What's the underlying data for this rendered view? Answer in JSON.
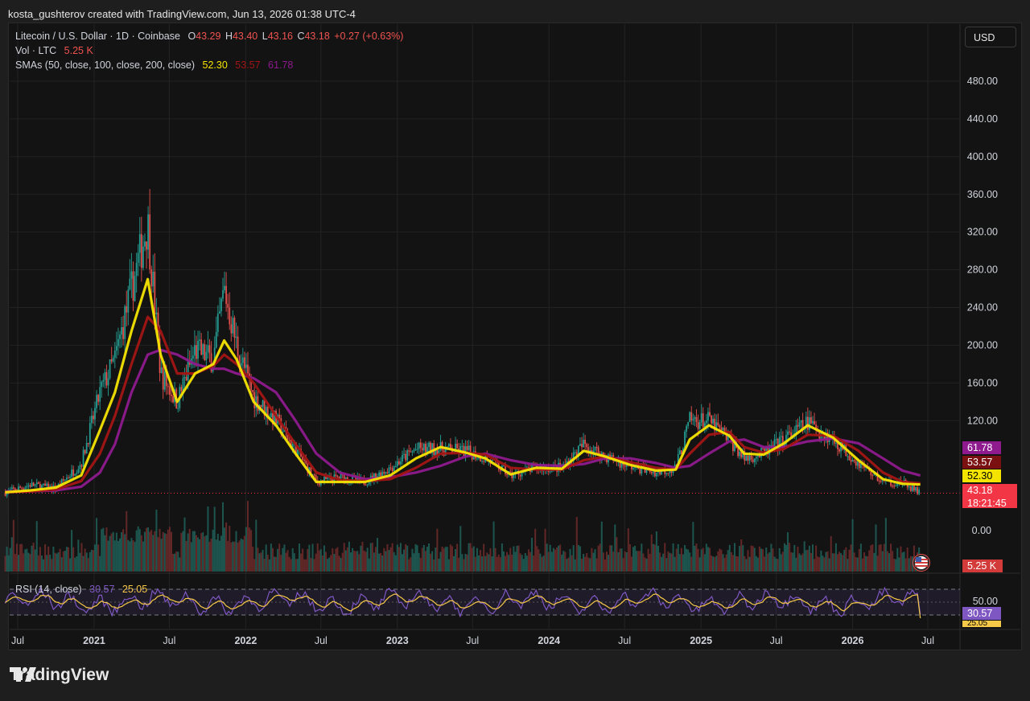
{
  "header": {
    "credit": "kosta_gushterov created with TradingView.com, Jun 13, 2026 01:38 UTC-4"
  },
  "legend": {
    "symbol": "Litecoin / U.S. Dollar · 1D · Coinbase",
    "o_label": "O",
    "o_value": "43.29",
    "h_label": "H",
    "h_value": "43.40",
    "l_label": "L",
    "l_value": "43.16",
    "c_label": "C",
    "c_value": "43.18",
    "change": "+0.27 (+0.63%)",
    "vol_label": "Vol · LTC",
    "vol_value": "5.25 K",
    "sma_label": "SMAs (50, close, 100, close, 200, close)",
    "sma50": "52.30",
    "sma100": "53.57",
    "sma200": "61.78",
    "rsi_label": "RSI (14, close)",
    "rsi_value": "30.57",
    "rsi_ma": "25.05"
  },
  "currency_button": "USD",
  "price_tags": {
    "sma200": "61.78",
    "sma100": "53.57",
    "sma50": "52.30",
    "last": "43.18",
    "countdown": "18:21:45",
    "volume": "5.25 K",
    "rsi": "30.57",
    "rsi_ma": "25.05"
  },
  "colors": {
    "up": "#26a69a",
    "down": "#ef5350",
    "sma50": "#f5e400",
    "sma100": "#a31515",
    "sma200": "#8e1a8e",
    "rsi": "#7e57c2",
    "rsi_ma": "#f7c948",
    "bg": "#131313",
    "grid": "#232323"
  },
  "footer": {
    "brand": "TradingView",
    "logo_icon": "tradingview-logo-icon"
  },
  "chart_data": [
    {
      "type": "line",
      "name": "price",
      "ylim": [
        0,
        500
      ],
      "y_ticks": [
        "480.00",
        "440.00",
        "400.00",
        "360.00",
        "320.00",
        "280.00",
        "240.00",
        "200.00",
        "160.00",
        "120.00"
      ],
      "x_ticks": [
        "Jul",
        "2021",
        "Jul",
        "2022",
        "Jul",
        "2023",
        "Jul",
        "2024",
        "Jul",
        "2025",
        "Jul",
        "2026",
        "Jul"
      ],
      "x_tick_dates": [
        "2020-07-01",
        "2021-01-01",
        "2021-07-01",
        "2022-01-01",
        "2022-07-01",
        "2023-01-01",
        "2023-07-01",
        "2024-01-01",
        "2024-07-01",
        "2025-01-01",
        "2025-07-01",
        "2026-01-01",
        "2026-07-01"
      ],
      "x": [
        "2020-06-01",
        "2020-08-01",
        "2020-10-01",
        "2020-12-01",
        "2021-01-15",
        "2021-02-20",
        "2021-04-01",
        "2021-05-10",
        "2021-06-10",
        "2021-07-20",
        "2021-09-01",
        "2021-10-15",
        "2021-11-10",
        "2021-12-10",
        "2022-01-20",
        "2022-03-15",
        "2022-05-01",
        "2022-06-20",
        "2022-08-15",
        "2022-10-15",
        "2022-12-15",
        "2023-02-15",
        "2023-04-15",
        "2023-06-15",
        "2023-08-01",
        "2023-10-01",
        "2023-12-01",
        "2024-02-01",
        "2024-03-25",
        "2024-05-15",
        "2024-07-15",
        "2024-09-15",
        "2024-11-01",
        "2024-12-05",
        "2025-01-20",
        "2025-03-10",
        "2025-04-15",
        "2025-06-01",
        "2025-07-20",
        "2025-09-15",
        "2025-11-15",
        "2026-01-15",
        "2026-03-15",
        "2026-05-01",
        "2026-06-13"
      ],
      "series": [
        {
          "name": "close",
          "values": [
            44,
            52,
            48,
            75,
            150,
            185,
            260,
            330,
            170,
            140,
            195,
            185,
            260,
            200,
            145,
            120,
            90,
            55,
            60,
            55,
            70,
            90,
            90,
            88,
            80,
            62,
            70,
            70,
            95,
            82,
            72,
            65,
            70,
            120,
            120,
            100,
            80,
            85,
            100,
            118,
            100,
            75,
            55,
            54,
            43.18
          ]
        },
        {
          "name": "SMA 50",
          "values": [
            44,
            46,
            49,
            62,
            110,
            150,
            215,
            270,
            190,
            140,
            170,
            180,
            205,
            185,
            140,
            115,
            85,
            55,
            55,
            55,
            62,
            80,
            92,
            86,
            80,
            63,
            70,
            69,
            88,
            82,
            73,
            67,
            68,
            100,
            115,
            104,
            85,
            84,
            96,
            115,
            102,
            78,
            58,
            53,
            52.3
          ]
        },
        {
          "name": "SMA 100",
          "values": [
            44,
            45,
            47,
            56,
            85,
            125,
            180,
            230,
            215,
            170,
            170,
            178,
            190,
            180,
            160,
            125,
            95,
            65,
            57,
            56,
            58,
            70,
            85,
            86,
            84,
            70,
            68,
            68,
            78,
            82,
            76,
            70,
            68,
            85,
            105,
            108,
            92,
            86,
            90,
            105,
            104,
            88,
            65,
            55,
            53.57
          ]
        },
        {
          "name": "SMA 200",
          "values": [
            45,
            45,
            46,
            50,
            65,
            95,
            150,
            190,
            195,
            190,
            180,
            175,
            175,
            170,
            165,
            150,
            120,
            85,
            65,
            58,
            60,
            65,
            72,
            82,
            85,
            78,
            73,
            72,
            74,
            80,
            80,
            75,
            70,
            72,
            85,
            98,
            100,
            92,
            92,
            98,
            101,
            96,
            80,
            67,
            61.78
          ]
        }
      ]
    },
    {
      "type": "bar",
      "name": "volume",
      "y_ticks": [
        "0.00"
      ],
      "last_value": "5.25 K"
    },
    {
      "type": "line",
      "name": "RSI",
      "ylim": [
        0,
        100
      ],
      "y_ticks": [
        "50.00"
      ],
      "bands": [
        70,
        30
      ],
      "series": [
        {
          "name": "RSI (14, close)",
          "last": 30.57
        },
        {
          "name": "RSI MA",
          "last": 25.05
        }
      ]
    }
  ]
}
